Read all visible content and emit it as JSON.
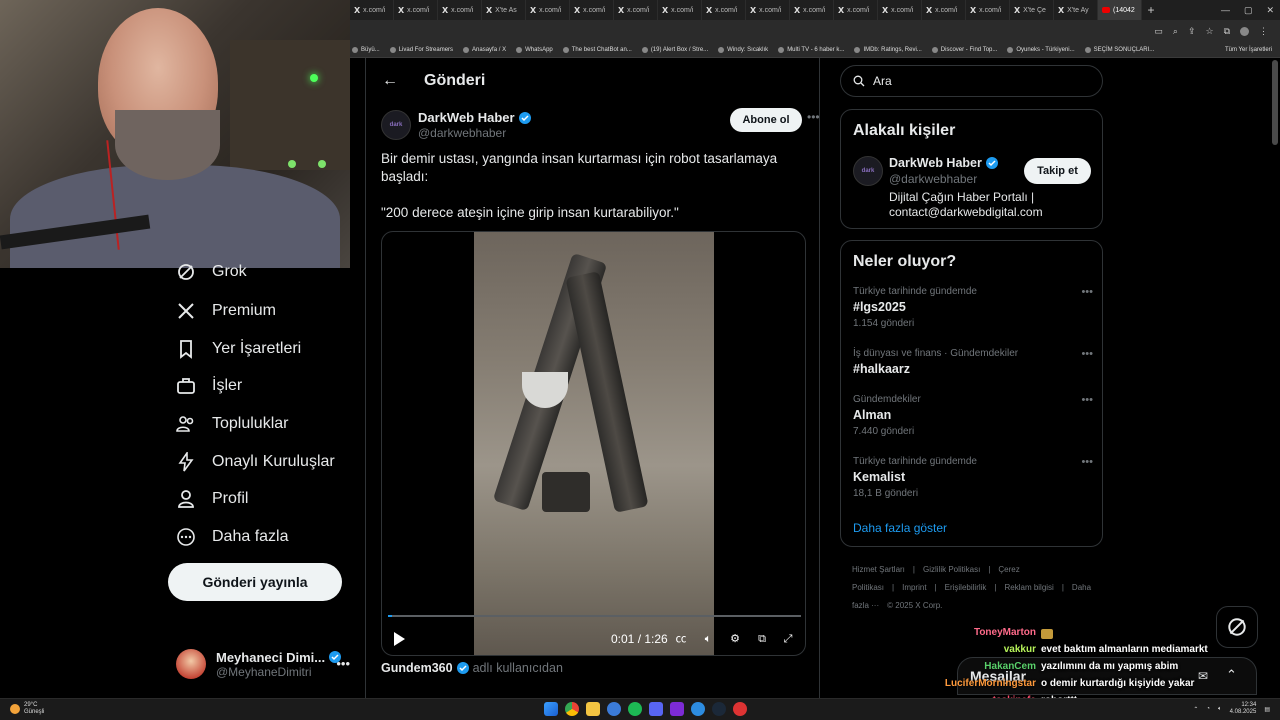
{
  "browser": {
    "tabs": [
      {
        "label": "x.com/i"
      },
      {
        "label": "x.com/i"
      },
      {
        "label": "x.com/i"
      },
      {
        "label": "X'te As"
      },
      {
        "label": "x.com/i"
      },
      {
        "label": "x.com/i"
      },
      {
        "label": "x.com/i"
      },
      {
        "label": "x.com/i"
      },
      {
        "label": "x.com/i"
      },
      {
        "label": "x.com/i"
      },
      {
        "label": "x.com/i"
      },
      {
        "label": "x.com/i"
      },
      {
        "label": "x.com/i"
      },
      {
        "label": "x.com/i"
      },
      {
        "label": "x.com/i"
      },
      {
        "label": "X'te Çe"
      },
      {
        "label": "X'te Ay"
      },
      {
        "label": "(14042"
      }
    ],
    "bookmarks": [
      "Büyü...",
      "Livad For Streamers",
      "Anasayfa / X",
      "WhatsApp",
      "The best ChatBot an...",
      "(19) Alert Box / Stre...",
      "Windy: Sıcaklık",
      "Multi TV - 6 haber k...",
      "IMDb: Ratings, Revi...",
      "Discover - Find Top...",
      "Oyuneks - Türkiyeni...",
      "SEÇİM SONUÇLARI..."
    ],
    "bookmarks_right": "Tüm Yer İşaretleri"
  },
  "nav": {
    "grok": "Grok",
    "premium": "Premium",
    "bookmarks": "Yer İşaretleri",
    "jobs": "İşler",
    "communities": "Topluluklar",
    "verified_orgs": "Onaylı Kuruluşlar",
    "profile": "Profil",
    "more": "Daha fazla",
    "post_button": "Gönderi yayınla",
    "account_name": "Meyhaneci Dimi...",
    "account_handle": "@MeyhaneDimitri"
  },
  "main": {
    "title": "Gönderi",
    "author_name": "DarkWeb Haber",
    "author_handle": "@darkwebhaber",
    "avatar_text": "dark",
    "subscribe": "Abone ol",
    "text_line1": "Bir demir ustası, yangında insan kurtarması için robot tasarlamaya başladı:",
    "text_line2": "\"200 derece ateşin içine girip insan kurtarabiliyor.\"",
    "video_time": "0:01 / 1:26",
    "video_progress": 0.01,
    "quote_source": "Gundem360",
    "quote_suffix": "adlı kullanıcıdan"
  },
  "right": {
    "search_placeholder": "Ara",
    "related_title": "Alakalı kişiler",
    "related_name": "DarkWeb Haber",
    "related_handle": "@darkwebhaber",
    "related_bio": "Dijital Çağın Haber Portalı | contact@darkwebdigital.com",
    "follow": "Takip et",
    "trends_title": "Neler oluyor?",
    "trends": [
      {
        "context": "Türkiye tarihinde gündemde",
        "topic": "#lgs2025",
        "count": "1.154 gönderi"
      },
      {
        "context": "İş dünyası ve finans · Gündemdekiler",
        "topic": "#halkaarz",
        "count": ""
      },
      {
        "context": "Gündemdekiler",
        "topic": "Alman",
        "count": "7.440 gönderi"
      },
      {
        "context": "Türkiye tarihinde gündemde",
        "topic": "Kemalist",
        "count": "18,1 B gönderi"
      }
    ],
    "show_more": "Daha fazla göster",
    "footer_links": [
      "Hizmet Şartları",
      "Gizlilik Politikası",
      "Çerez Politikası",
      "Imprint",
      "Erişilebilirlik",
      "Reklam bilgisi"
    ],
    "footer_more": "Daha fazla ···",
    "footer_copy": "© 2025 X Corp."
  },
  "messages": {
    "label": "Mesajlar"
  },
  "chat": [
    {
      "user": "ToneyMarton",
      "color": "#ff6b8a",
      "message": ""
    },
    {
      "user": "vakkur",
      "color": "#b7f35a",
      "message": "evet baktım almanların mediamarkt"
    },
    {
      "user": "HakanCem",
      "color": "#5ad16b",
      "message": "yazılımını da mı yapmış abim"
    },
    {
      "user": "LuciferMorningstar",
      "color": "#ff9a3c",
      "message": "o demir kurtardığı kişiyide yakar"
    },
    {
      "user": "taskinefe",
      "color": "#ff4f6f",
      "message": "roborttt"
    }
  ],
  "taskbar": {
    "temp": "29°C",
    "weather": "Güneşli",
    "time": "12:34",
    "date": "4.08.2025"
  },
  "colors": {
    "accent": "#1d9bf0",
    "background": "#000000",
    "border": "#2f3336"
  }
}
